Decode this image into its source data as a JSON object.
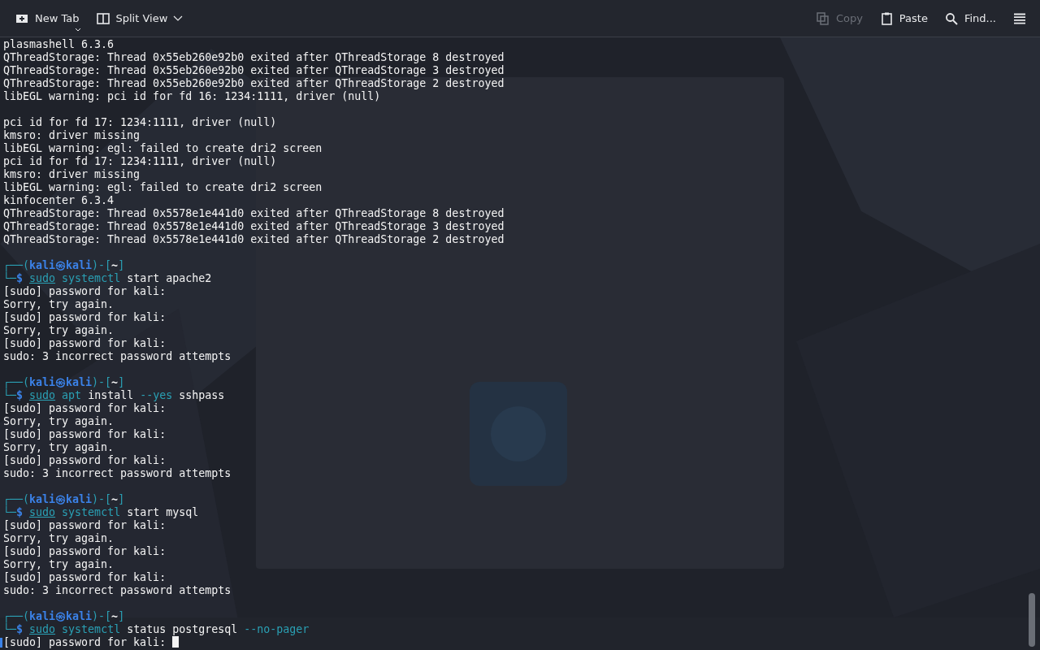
{
  "toolbar": {
    "new_tab": {
      "label": "New Tab"
    },
    "split_view": {
      "label": "Split View"
    },
    "copy": {
      "label": "Copy",
      "disabled": true
    },
    "paste": {
      "label": "Paste",
      "disabled": false
    },
    "find": {
      "label": "Find..."
    }
  },
  "terminal": {
    "lines": [
      {
        "kind": "text",
        "text": "plasmashell 6.3.6"
      },
      {
        "kind": "text",
        "text": "QThreadStorage: Thread 0x55eb260e92b0 exited after QThreadStorage 8 destroyed"
      },
      {
        "kind": "text",
        "text": "QThreadStorage: Thread 0x55eb260e92b0 exited after QThreadStorage 3 destroyed"
      },
      {
        "kind": "text",
        "text": "QThreadStorage: Thread 0x55eb260e92b0 exited after QThreadStorage 2 destroyed"
      },
      {
        "kind": "text",
        "text": "libEGL warning: pci id for fd 16: 1234:1111, driver (null)"
      },
      {
        "kind": "blank"
      },
      {
        "kind": "text",
        "text": "pci id for fd 17: 1234:1111, driver (null)"
      },
      {
        "kind": "text",
        "text": "kmsro: driver missing"
      },
      {
        "kind": "text",
        "text": "libEGL warning: egl: failed to create dri2 screen"
      },
      {
        "kind": "text",
        "text": "pci id for fd 17: 1234:1111, driver (null)"
      },
      {
        "kind": "text",
        "text": "kmsro: driver missing"
      },
      {
        "kind": "text",
        "text": "libEGL warning: egl: failed to create dri2 screen"
      },
      {
        "kind": "text",
        "text": "kinfocenter 6.3.4"
      },
      {
        "kind": "text",
        "text": "QThreadStorage: Thread 0x5578e1e441d0 exited after QThreadStorage 8 destroyed"
      },
      {
        "kind": "text",
        "text": "QThreadStorage: Thread 0x5578e1e441d0 exited after QThreadStorage 3 destroyed"
      },
      {
        "kind": "text",
        "text": "QThreadStorage: Thread 0x5578e1e441d0 exited after QThreadStorage 2 destroyed"
      },
      {
        "kind": "blank"
      },
      {
        "kind": "segments",
        "segments": [
          {
            "text": "┌──(",
            "kind": "frame"
          },
          {
            "text": "kali㉿kali",
            "kind": "user"
          },
          {
            "text": ")-[",
            "kind": "frame"
          },
          {
            "text": "~",
            "kind": "path"
          },
          {
            "text": "]",
            "kind": "frame"
          }
        ]
      },
      {
        "kind": "segments",
        "segments": [
          {
            "text": "└─",
            "kind": "frame"
          },
          {
            "text": "$",
            "kind": "user"
          },
          {
            "text": "sudo",
            "kind": "sudo"
          },
          {
            "text": "systemctl",
            "kind": "command"
          },
          {
            "text": "start apache2",
            "kind": "plain"
          }
        ]
      },
      {
        "kind": "text",
        "text": "[sudo] password for kali:"
      },
      {
        "kind": "text",
        "text": "Sorry, try again."
      },
      {
        "kind": "text",
        "text": "[sudo] password for kali:"
      },
      {
        "kind": "text",
        "text": "Sorry, try again."
      },
      {
        "kind": "text",
        "text": "[sudo] password for kali:"
      },
      {
        "kind": "text",
        "text": "sudo: 3 incorrect password attempts"
      },
      {
        "kind": "blank"
      },
      {
        "kind": "segments",
        "segments": [
          {
            "text": "┌──(",
            "kind": "frame"
          },
          {
            "text": "kali㉿kali",
            "kind": "user"
          },
          {
            "text": ")-[",
            "kind": "frame"
          },
          {
            "text": "~",
            "kind": "path"
          },
          {
            "text": "]",
            "kind": "frame"
          }
        ]
      },
      {
        "kind": "segments",
        "segments": [
          {
            "text": "└─",
            "kind": "frame"
          },
          {
            "text": "$",
            "kind": "user"
          },
          {
            "text": "sudo",
            "kind": "sudo"
          },
          {
            "text": "apt",
            "kind": "command"
          },
          {
            "text": "install",
            "kind": "plain"
          },
          {
            "text": "--yes",
            "kind": "option"
          },
          {
            "text": "sshpass",
            "kind": "plain"
          }
        ]
      },
      {
        "kind": "text",
        "text": "[sudo] password for kali:"
      },
      {
        "kind": "text",
        "text": "Sorry, try again."
      },
      {
        "kind": "text",
        "text": "[sudo] password for kali:"
      },
      {
        "kind": "text",
        "text": "Sorry, try again."
      },
      {
        "kind": "text",
        "text": "[sudo] password for kali:"
      },
      {
        "kind": "text",
        "text": "sudo: 3 incorrect password attempts"
      },
      {
        "kind": "blank"
      },
      {
        "kind": "segments",
        "segments": [
          {
            "text": "┌──(",
            "kind": "frame"
          },
          {
            "text": "kali㉿kali",
            "kind": "user"
          },
          {
            "text": ")-[",
            "kind": "frame"
          },
          {
            "text": "~",
            "kind": "path"
          },
          {
            "text": "]",
            "kind": "frame"
          }
        ]
      },
      {
        "kind": "segments",
        "segments": [
          {
            "text": "└─",
            "kind": "frame"
          },
          {
            "text": "$",
            "kind": "user"
          },
          {
            "text": "sudo",
            "kind": "sudo"
          },
          {
            "text": "systemctl",
            "kind": "command"
          },
          {
            "text": "start mysql",
            "kind": "plain"
          }
        ]
      },
      {
        "kind": "text",
        "text": "[sudo] password for kali:"
      },
      {
        "kind": "text",
        "text": "Sorry, try again."
      },
      {
        "kind": "text",
        "text": "[sudo] password for kali:"
      },
      {
        "kind": "text",
        "text": "Sorry, try again."
      },
      {
        "kind": "text",
        "text": "[sudo] password for kali:"
      },
      {
        "kind": "text",
        "text": "sudo: 3 incorrect password attempts"
      },
      {
        "kind": "blank"
      },
      {
        "kind": "segments",
        "segments": [
          {
            "text": "┌──(",
            "kind": "frame"
          },
          {
            "text": "kali㉿kali",
            "kind": "user"
          },
          {
            "text": ")-[",
            "kind": "frame"
          },
          {
            "text": "~",
            "kind": "path"
          },
          {
            "text": "]",
            "kind": "frame"
          }
        ]
      },
      {
        "kind": "segments",
        "segments": [
          {
            "text": "└─",
            "kind": "frame"
          },
          {
            "text": "$",
            "kind": "user"
          },
          {
            "text": "sudo",
            "kind": "sudo"
          },
          {
            "text": "systemctl",
            "kind": "command"
          },
          {
            "text": "status postgresql",
            "kind": "plain"
          },
          {
            "text": "--no-pager",
            "kind": "option"
          }
        ]
      },
      {
        "kind": "input",
        "text": "[sudo] password for kali:",
        "cursor": true
      }
    ]
  }
}
